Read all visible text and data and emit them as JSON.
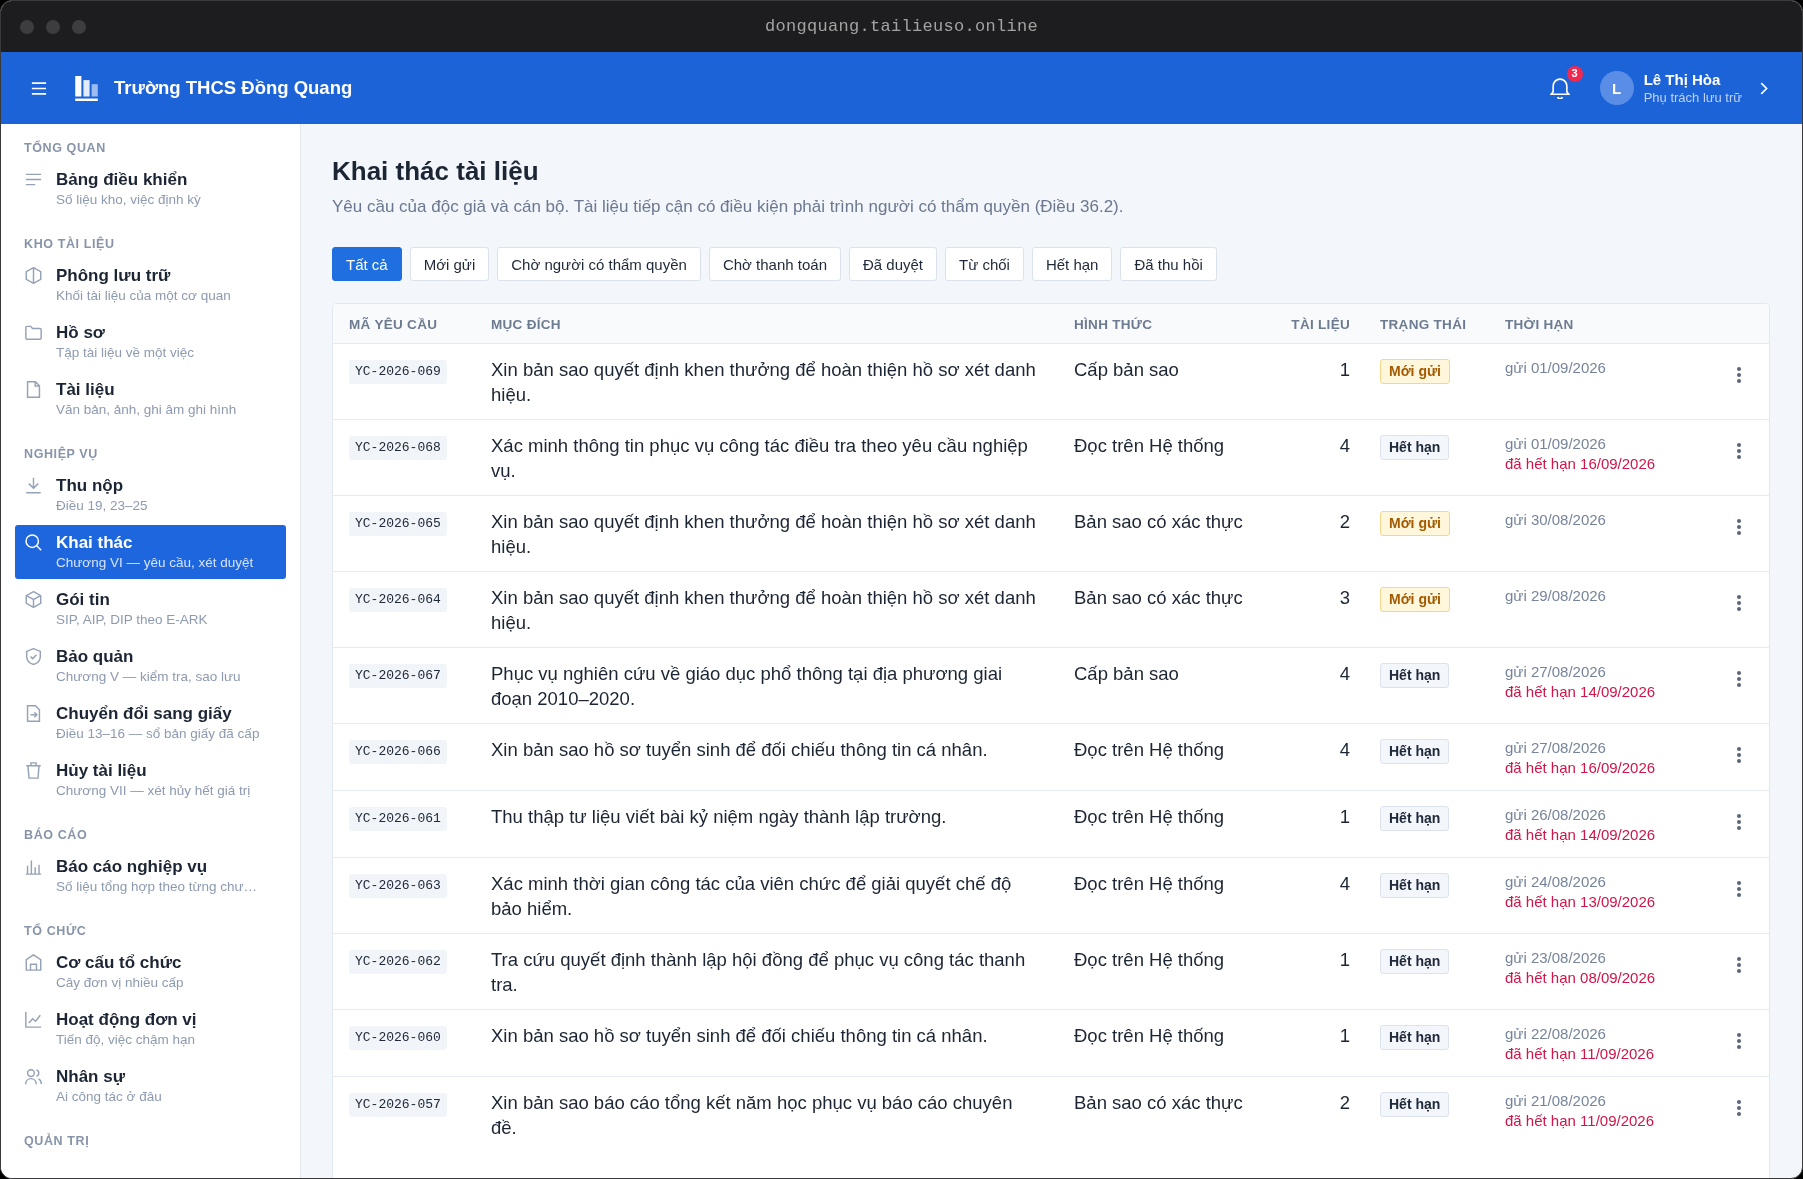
{
  "window": {
    "url": "dongquang.tailieuso.online"
  },
  "header": {
    "title": "Trường THCS Đồng Quang",
    "notifications": "3",
    "user": {
      "initial": "L",
      "name": "Lê Thị Hòa",
      "role": "Phụ trách lưu trữ"
    }
  },
  "sidebar": {
    "sections": [
      {
        "label": "TỔNG QUAN",
        "items": [
          {
            "title": "Bảng điều khiển",
            "subtitle": "Số liệu kho, việc định kỳ",
            "selected": false
          }
        ]
      },
      {
        "label": "KHO TÀI LIỆU",
        "items": [
          {
            "title": "Phông lưu trữ",
            "subtitle": "Khối tài liệu của một cơ quan",
            "selected": false
          },
          {
            "title": "Hồ sơ",
            "subtitle": "Tập tài liệu về một việc",
            "selected": false
          },
          {
            "title": "Tài liệu",
            "subtitle": "Văn bản, ảnh, ghi âm ghi hình",
            "selected": false
          }
        ]
      },
      {
        "label": "NGHIỆP VỤ",
        "items": [
          {
            "title": "Thu nộp",
            "subtitle": "Điều 19, 23–25",
            "selected": false
          },
          {
            "title": "Khai thác",
            "subtitle": "Chương VI — yêu cầu, xét duyệt",
            "selected": true
          },
          {
            "title": "Gói tin",
            "subtitle": "SIP, AIP, DIP theo E-ARK",
            "selected": false
          },
          {
            "title": "Bảo quản",
            "subtitle": "Chương V — kiểm tra, sao lưu",
            "selected": false
          },
          {
            "title": "Chuyển đổi sang giấy",
            "subtitle": "Điều 13–16 — sổ bản giấy đã cấp",
            "selected": false
          },
          {
            "title": "Hủy tài liệu",
            "subtitle": "Chương VII — xét hủy hết giá trị",
            "selected": false
          }
        ]
      },
      {
        "label": "BÁO CÁO",
        "items": [
          {
            "title": "Báo cáo nghiệp vụ",
            "subtitle": "Số liệu tổng hợp theo từng chư…",
            "selected": false
          }
        ]
      },
      {
        "label": "TỔ CHỨC",
        "items": [
          {
            "title": "Cơ cấu tổ chức",
            "subtitle": "Cây đơn vị nhiều cấp",
            "selected": false
          },
          {
            "title": "Hoạt động đơn vị",
            "subtitle": "Tiến độ, việc chậm hạn",
            "selected": false
          },
          {
            "title": "Nhân sự",
            "subtitle": "Ai công tác ở đâu",
            "selected": false
          }
        ]
      },
      {
        "label": "QUẢN TRỊ"
      }
    ]
  },
  "page": {
    "title": "Khai thác tài liệu",
    "description": "Yêu cầu của độc giả và cán bộ. Tài liệu tiếp cận có điều kiện phải trình người có thẩm quyền (Điều 36.2)."
  },
  "tabs": [
    {
      "label": "Tất cả",
      "selected": true
    },
    {
      "label": "Mới gửi",
      "selected": false
    },
    {
      "label": "Chờ người có thẩm quyền",
      "selected": false
    },
    {
      "label": "Chờ thanh toán",
      "selected": false
    },
    {
      "label": "Đã duyệt",
      "selected": false
    },
    {
      "label": "Từ chối",
      "selected": false
    },
    {
      "label": "Hết hạn",
      "selected": false
    },
    {
      "label": "Đã thu hồi",
      "selected": false
    }
  ],
  "table": {
    "columns": [
      "MÃ YÊU CẦU",
      "MỤC ĐÍCH",
      "HÌNH THỨC",
      "TÀI LIỆU",
      "TRẠNG THÁI",
      "THỜI HẠN"
    ],
    "rows": [
      {
        "code": "YC-2026-069",
        "purpose": "Xin bản sao quyết định khen thưởng để hoàn thiện hồ sơ xét danh hiệu.",
        "form": "Cấp bản sao",
        "count": "1",
        "status": {
          "label": "Mới gửi",
          "kind": "new"
        },
        "sent": "gửi 01/09/2026"
      },
      {
        "code": "YC-2026-068",
        "purpose": "Xác minh thông tin phục vụ công tác điều tra theo yêu cầu nghiệp vụ.",
        "form": "Đọc trên Hệ thống",
        "count": "4",
        "status": {
          "label": "Hết hạn",
          "kind": "expired"
        },
        "sent": "gửi 01/09/2026",
        "expiry": "đã hết hạn 16/09/2026"
      },
      {
        "code": "YC-2026-065",
        "purpose": "Xin bản sao quyết định khen thưởng để hoàn thiện hồ sơ xét danh hiệu.",
        "form": "Bản sao có xác thực",
        "count": "2",
        "status": {
          "label": "Mới gửi",
          "kind": "new"
        },
        "sent": "gửi 30/08/2026"
      },
      {
        "code": "YC-2026-064",
        "purpose": "Xin bản sao quyết định khen thưởng để hoàn thiện hồ sơ xét danh hiệu.",
        "form": "Bản sao có xác thực",
        "count": "3",
        "status": {
          "label": "Mới gửi",
          "kind": "new"
        },
        "sent": "gửi 29/08/2026"
      },
      {
        "code": "YC-2026-067",
        "purpose": "Phục vụ nghiên cứu về giáo dục phổ thông tại địa phương giai đoạn 2010–2020.",
        "form": "Cấp bản sao",
        "count": "4",
        "status": {
          "label": "Hết hạn",
          "kind": "expired"
        },
        "sent": "gửi 27/08/2026",
        "expiry": "đã hết hạn 14/09/2026"
      },
      {
        "code": "YC-2026-066",
        "purpose": "Xin bản sao hồ sơ tuyển sinh để đối chiếu thông tin cá nhân.",
        "form": "Đọc trên Hệ thống",
        "count": "4",
        "status": {
          "label": "Hết hạn",
          "kind": "expired"
        },
        "sent": "gửi 27/08/2026",
        "expiry": "đã hết hạn 16/09/2026"
      },
      {
        "code": "YC-2026-061",
        "purpose": "Thu thập tư liệu viết bài kỷ niệm ngày thành lập trường.",
        "form": "Đọc trên Hệ thống",
        "count": "1",
        "status": {
          "label": "Hết hạn",
          "kind": "expired"
        },
        "sent": "gửi 26/08/2026",
        "expiry": "đã hết hạn 14/09/2026"
      },
      {
        "code": "YC-2026-063",
        "purpose": "Xác minh thời gian công tác của viên chức để giải quyết chế độ bảo hiểm.",
        "form": "Đọc trên Hệ thống",
        "count": "4",
        "status": {
          "label": "Hết hạn",
          "kind": "expired"
        },
        "sent": "gửi 24/08/2026",
        "expiry": "đã hết hạn 13/09/2026"
      },
      {
        "code": "YC-2026-062",
        "purpose": "Tra cứu quyết định thành lập hội đồng để phục vụ công tác thanh tra.",
        "form": "Đọc trên Hệ thống",
        "count": "1",
        "status": {
          "label": "Hết hạn",
          "kind": "expired"
        },
        "sent": "gửi 23/08/2026",
        "expiry": "đã hết hạn 08/09/2026"
      },
      {
        "code": "YC-2026-060",
        "purpose": "Xin bản sao hồ sơ tuyển sinh để đối chiếu thông tin cá nhân.",
        "form": "Đọc trên Hệ thống",
        "count": "1",
        "status": {
          "label": "Hết hạn",
          "kind": "expired"
        },
        "sent": "gửi 22/08/2026",
        "expiry": "đã hết hạn 11/09/2026"
      },
      {
        "code": "YC-2026-057",
        "purpose": "Xin bản sao báo cáo tổng kết năm học phục vụ báo cáo chuyên đề.",
        "form": "Bản sao có xác thực",
        "count": "2",
        "status": {
          "label": "Hết hạn",
          "kind": "expired"
        },
        "sent": "gửi 21/08/2026",
        "expiry": "đã hết hạn 11/09/2026"
      }
    ]
  }
}
